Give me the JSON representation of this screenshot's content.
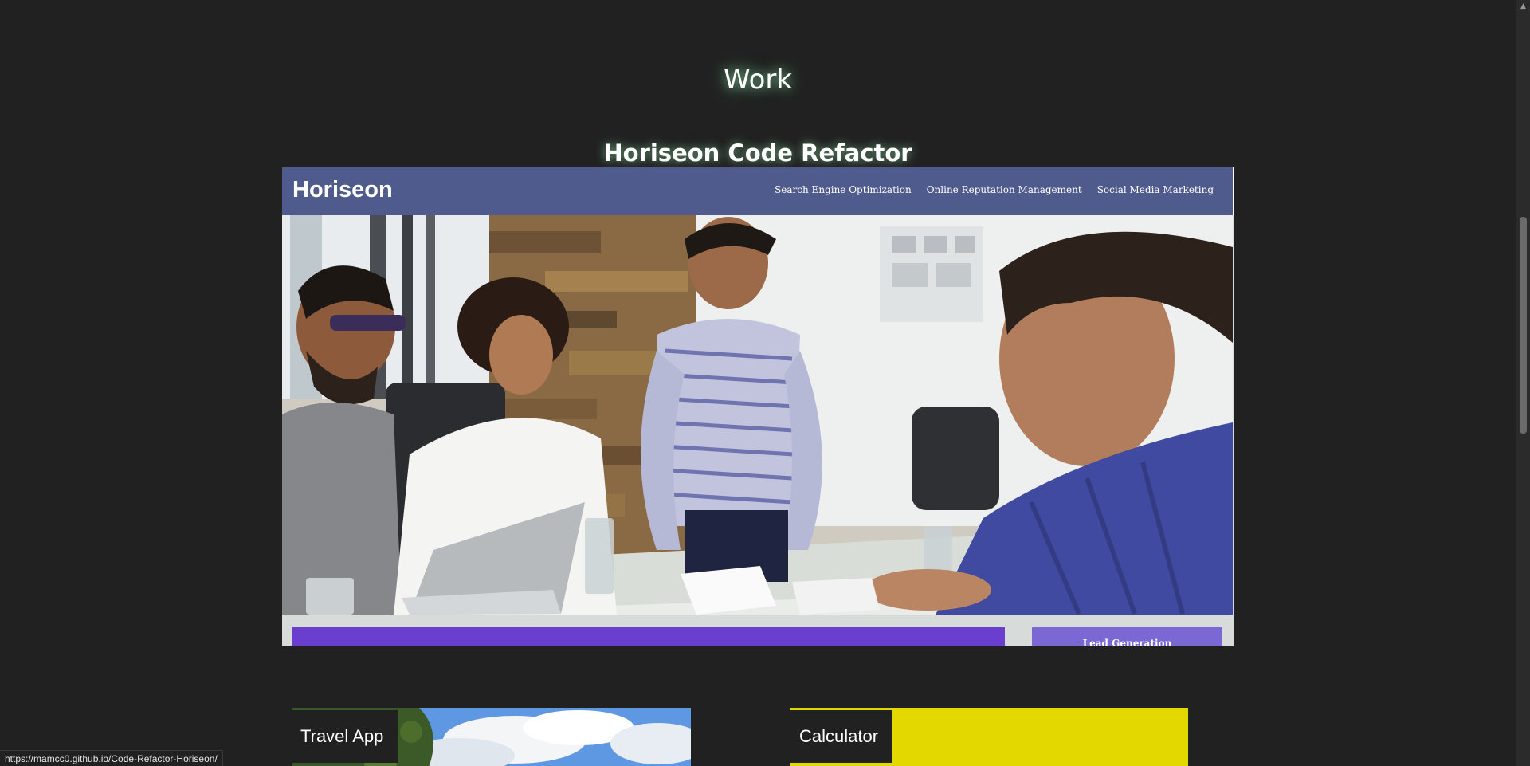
{
  "work": {
    "title": "Work",
    "featured": {
      "title": "Horiseon Code Refactor",
      "screenshot": {
        "logo": "Horiseon",
        "nav": [
          "Search Engine Optimization",
          "Online Reputation Management",
          "Social Media Marketing"
        ],
        "sidebar_heading": "Lead Generation"
      }
    },
    "projects": [
      {
        "title": "Travel App"
      },
      {
        "title": "Calculator"
      }
    ]
  },
  "status_bar": {
    "url": "https://mamcc0.github.io/Code-Refactor-Horiseon/"
  },
  "colors": {
    "background": "#212121",
    "horiseon_header": "#4f5b8c",
    "calculator_card": "#e3d900",
    "lead_strip": "#6a3fcf"
  },
  "icons": {
    "scroll_up": "triangle-up"
  }
}
